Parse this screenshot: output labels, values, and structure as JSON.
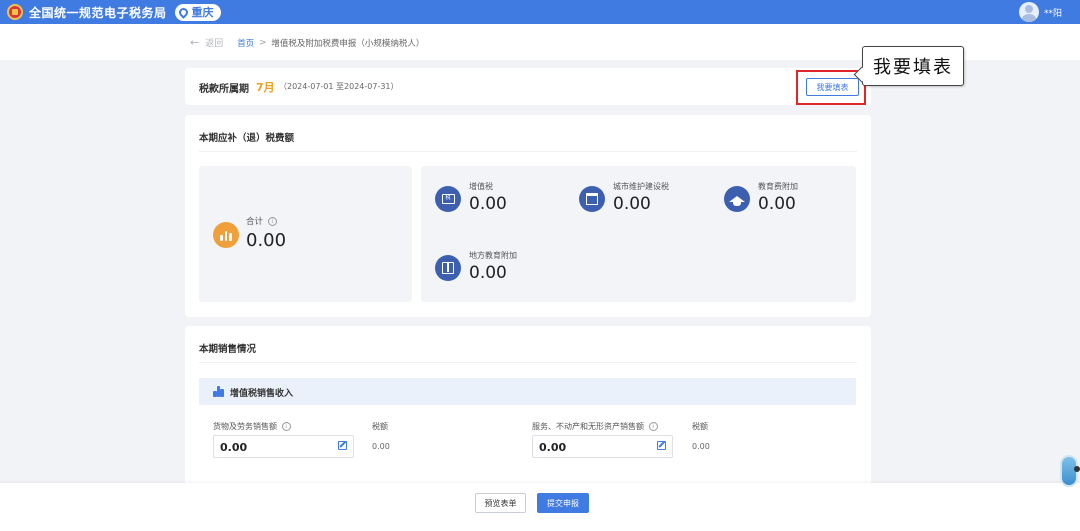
{
  "header": {
    "title": "全国统一规范电子税务局",
    "region": "重庆",
    "user_name": "**阳",
    "icons": {
      "logo": "tax-bureau-logo",
      "region": "location-pin-icon",
      "avatar": "user-avatar-icon"
    }
  },
  "breadcrumb": {
    "back_label": "返回",
    "home_label": "首页",
    "separator": ">",
    "current": "增值税及附加税费申报（小规模纳税人）"
  },
  "period": {
    "label": "税款所属期",
    "month": "7月",
    "range": "（2024-07-01 至2024-07-31）",
    "fill_button": "我要填表"
  },
  "callout": {
    "text": "我要填表"
  },
  "tax_summary": {
    "title": "本期应补（退）税费额",
    "total_label": "合计",
    "total_value": "0.00",
    "items": [
      {
        "name": "增值税",
        "value": "0.00",
        "icon": "receipt-icon"
      },
      {
        "name": "城市维护建设税",
        "value": "0.00",
        "icon": "building-icon"
      },
      {
        "name": "教育费附加",
        "value": "0.00",
        "icon": "graduation-cap-icon"
      },
      {
        "name": "地方教育附加",
        "value": "0.00",
        "icon": "book-icon"
      }
    ]
  },
  "sales": {
    "title": "本期销售情况",
    "subheader": "增值税销售收入",
    "fields": [
      {
        "label": "货物及劳务销售额",
        "value": "0.00",
        "tax_label": "税额",
        "tax_value": "0.00"
      },
      {
        "label": "服务、不动产和无形资产销售额",
        "value": "0.00",
        "tax_label": "税额",
        "tax_value": "0.00"
      }
    ]
  },
  "footer": {
    "preview_button": "预览表单",
    "submit_button": "提交申报"
  },
  "colors": {
    "primary": "#3f7be0",
    "accent": "#f0a020",
    "highlight": "#e0252b"
  }
}
